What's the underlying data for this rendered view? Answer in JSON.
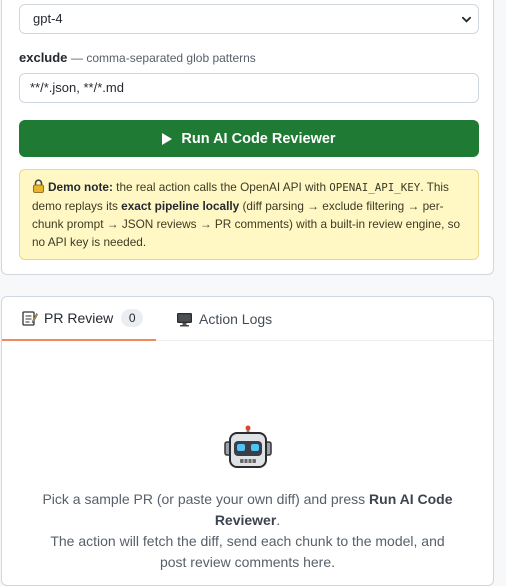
{
  "config": {
    "model_select": {
      "value": "gpt-4"
    },
    "exclude": {
      "label": "exclude",
      "hint": "— comma-separated glob patterns",
      "value": "**/*.json, **/*.md"
    },
    "run_button": {
      "label": "Run AI Code Reviewer",
      "icon": "play-icon"
    },
    "demo_note": {
      "title": "Demo note:",
      "text_1": " the real action calls the OpenAI API with ",
      "code": "OPENAI_API_KEY",
      "text_2": ". This demo replays its ",
      "bold": "exact pipeline locally",
      "text_3": " (diff parsing → exclude filtering → per-chunk prompt → JSON reviews → PR comments) with a built-in review engine, so no API key is needed.",
      "icon": "lock-icon"
    }
  },
  "tabs": [
    {
      "label": "PR Review",
      "count": "0",
      "icon": "memo-icon"
    },
    {
      "label": "Action Logs",
      "icon": "monitor-icon"
    }
  ],
  "empty_state": {
    "icon": "robot-icon",
    "line_1a": "Pick a sample PR (or paste your own diff) and press ",
    "line_1b": "Run AI Code Reviewer",
    "line_1c": ".",
    "line_2": "The action will fetch the diff, send each chunk to the model, and post review comments here."
  },
  "colors": {
    "accent_green": "#1f7a34",
    "tab_underline": "#f08a5d",
    "note_bg": "#fff8c5"
  }
}
